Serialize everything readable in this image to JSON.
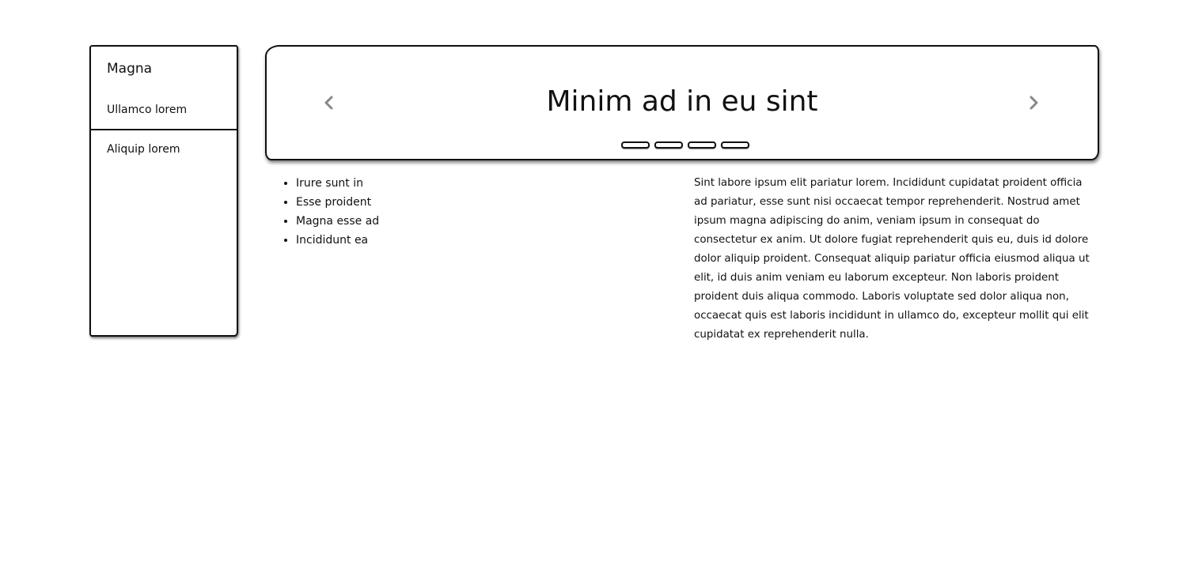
{
  "sidebar": {
    "title": "Magna",
    "items": [
      {
        "label": "Ullamco lorem"
      },
      {
        "label": "Aliquip lorem"
      }
    ]
  },
  "carousel": {
    "title": "Minim ad in eu sint",
    "prev_icon": "chevron-left-icon",
    "next_icon": "chevron-right-icon",
    "arrow_color": "#888888",
    "dots": [
      {
        "active": false
      },
      {
        "active": false
      },
      {
        "active": false
      },
      {
        "active": false
      }
    ]
  },
  "list": {
    "items": [
      "Irure sunt in",
      "Esse proident",
      "Magna esse ad",
      "Incididunt ea"
    ]
  },
  "paragraph": {
    "text": "Sint labore ipsum elit pariatur lorem. Incididunt cupidatat proident officia ad pariatur, esse sunt nisi occaecat tempor reprehenderit. Nostrud amet ipsum magna adipiscing do anim, veniam ipsum in consequat do consectetur ex anim. Ut dolore fugiat reprehenderit quis eu, duis id dolore dolor aliquip proident. Consequat aliquip pariatur officia eiusmod aliqua ut elit, id duis anim veniam eu laborum excepteur. Non laboris proident proident duis aliqua commodo. Laboris voluptate sed dolor aliqua non, occaecat quis est laboris incididunt in ullamco do, excepteur mollit qui elit cupidatat ex reprehenderit nulla."
  }
}
